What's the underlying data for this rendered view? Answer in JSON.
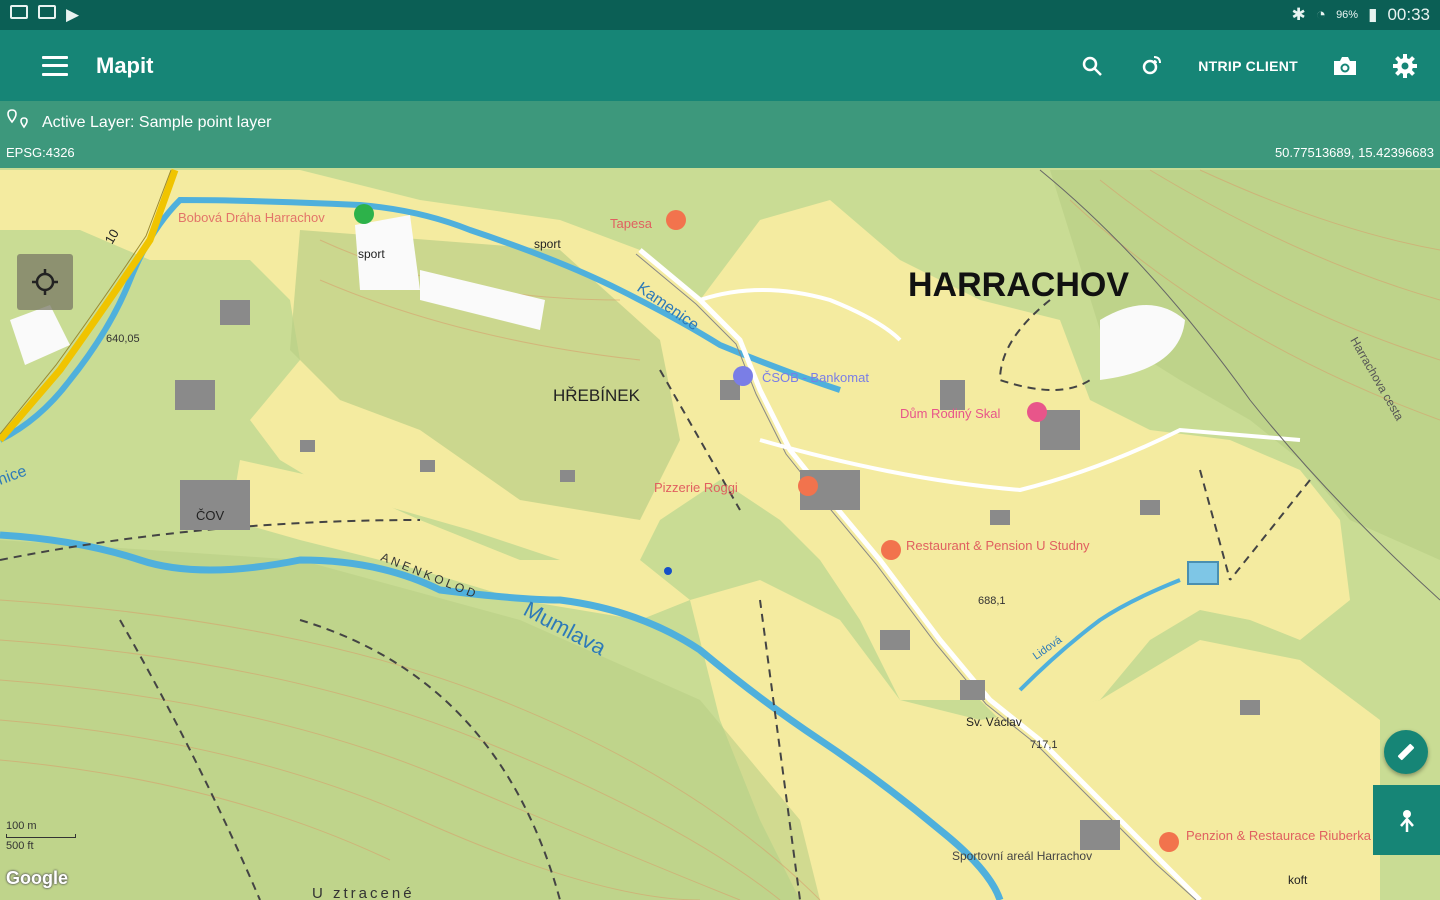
{
  "status_bar": {
    "time": "00:33",
    "battery": "96%"
  },
  "app_bar": {
    "title": "Mapit",
    "ntrip_label": "NTRIP CLIENT"
  },
  "info_bar": {
    "active_layer": "Active Layer: Sample point layer",
    "crs": "EPSG:4326",
    "coordinates": "50.77513689, 15.42396683"
  },
  "map": {
    "labels": {
      "town": "HARRACHOV",
      "hrebinek": "HŘEBÍNEK",
      "mumlava": "Mumlava",
      "kamenice": "Kamenice",
      "ice": "nice",
      "cov": "ČOV",
      "sport1": "sport",
      "sport2": "sport",
      "road": "10",
      "elev1": "640,05",
      "elev2": "688,1",
      "elev3": "717,1",
      "ztracene": "U ztracené",
      "lidova": "Lidová",
      "bobova": "Bobová Dráha Harrachov",
      "csob": "ČSOB - Bankomat",
      "pizzeria": "Pizzerie Roggi",
      "restaurant": "Restaurant & Pension U Studny",
      "dum": "Dům Rodiný Skal",
      "penzion": "Penzion & Restaurace Riuberka",
      "sportovni": "Sportovní areál Harrachov",
      "vaclav": "Sv. Václav",
      "kott": "koft",
      "harrachova": "Harrachova cesta",
      "ane": "A  N  E  N  K  O  L  O  D",
      "tapesa": "Tapesa"
    },
    "scale_label": "100 m",
    "scale_label2": "500 ft",
    "attribution": "Google"
  },
  "colors": {
    "status_bar": "#0b5f55",
    "app_bar": "#168576",
    "map_green": "#c9dc94",
    "map_yellow": "#f5eca2",
    "river": "#4fb0dc",
    "poi": "#f2734d"
  },
  "icons": {
    "menu": "hamburger-menu-icon",
    "search": "search-icon",
    "gps": "gps-satellite-icon",
    "camera": "camera-icon",
    "settings": "gear-icon",
    "location": "my-location-icon",
    "edit": "ruler-edit-icon",
    "point": "add-point-icon"
  }
}
